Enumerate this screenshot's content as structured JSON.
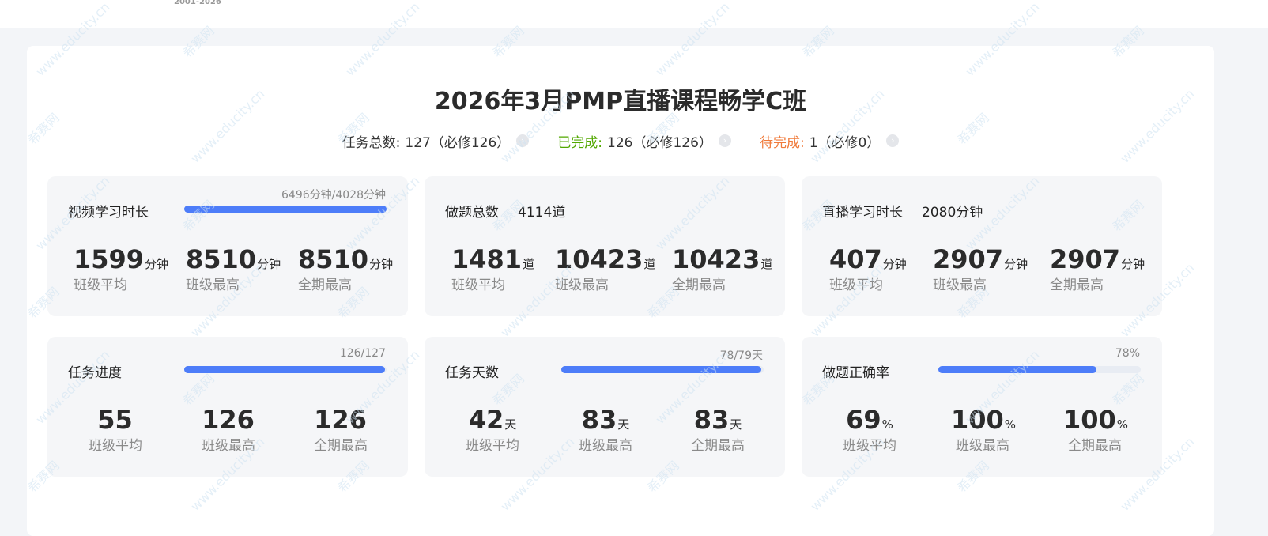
{
  "header": {
    "years": "2001-2026"
  },
  "course": {
    "title": "2026年3月PMP直播课程畅学C班"
  },
  "summary": [
    {
      "label": "任务总数:",
      "value": "127（必修126）",
      "color": "#333333"
    },
    {
      "label": "已完成:",
      "value": "126（必修126）",
      "color": "#52a800"
    },
    {
      "label": "待完成:",
      "value": "1（必修0）",
      "color": "#f07a3a"
    }
  ],
  "cards": [
    {
      "label": "视频学习时长",
      "total": "",
      "bar_text": "6496分钟/4028分钟",
      "bar_percent": 100,
      "stats": [
        {
          "num": "1599",
          "unit": "分钟",
          "cap": "班级平均"
        },
        {
          "num": "8510",
          "unit": "分钟",
          "cap": "班级最高"
        },
        {
          "num": "8510",
          "unit": "分钟",
          "cap": "全期最高"
        }
      ]
    },
    {
      "label": "做题总数",
      "total": "4114道",
      "bar_text": "",
      "bar_percent": null,
      "stats": [
        {
          "num": "1481",
          "unit": "道",
          "cap": "班级平均"
        },
        {
          "num": "10423",
          "unit": "道",
          "cap": "班级最高"
        },
        {
          "num": "10423",
          "unit": "道",
          "cap": "全期最高"
        }
      ]
    },
    {
      "label": "直播学习时长",
      "total": "2080分钟",
      "bar_text": "",
      "bar_percent": null,
      "stats": [
        {
          "num": "407",
          "unit": "分钟",
          "cap": "班级平均"
        },
        {
          "num": "2907",
          "unit": "分钟",
          "cap": "班级最高"
        },
        {
          "num": "2907",
          "unit": "分钟",
          "cap": "全期最高"
        }
      ]
    },
    {
      "label": "任务进度",
      "total": "",
      "bar_text": "126/127",
      "bar_percent": 99.2,
      "stats": [
        {
          "num": "55",
          "unit": "",
          "cap": "班级平均"
        },
        {
          "num": "126",
          "unit": "",
          "cap": "班级最高"
        },
        {
          "num": "126",
          "unit": "",
          "cap": "全期最高"
        }
      ]
    },
    {
      "label": "任务天数",
      "total": "",
      "bar_text": "78/79天",
      "bar_percent": 98.7,
      "stats": [
        {
          "num": "42",
          "unit": "天",
          "cap": "班级平均"
        },
        {
          "num": "83",
          "unit": "天",
          "cap": "班级最高"
        },
        {
          "num": "83",
          "unit": "天",
          "cap": "全期最高"
        }
      ]
    },
    {
      "label": "做题正确率",
      "total": "",
      "bar_text": "78%",
      "bar_percent": 78,
      "stats": [
        {
          "num": "69",
          "unit": "%",
          "cap": "班级平均"
        },
        {
          "num": "100",
          "unit": "%",
          "cap": "班级最高"
        },
        {
          "num": "100",
          "unit": "%",
          "cap": "全期最高"
        }
      ]
    }
  ],
  "watermarks": [
    "www.educity.cn",
    "希赛网"
  ],
  "colors": {
    "accent": "#4d7df9",
    "done": "#52a800",
    "pending": "#f07a3a"
  }
}
